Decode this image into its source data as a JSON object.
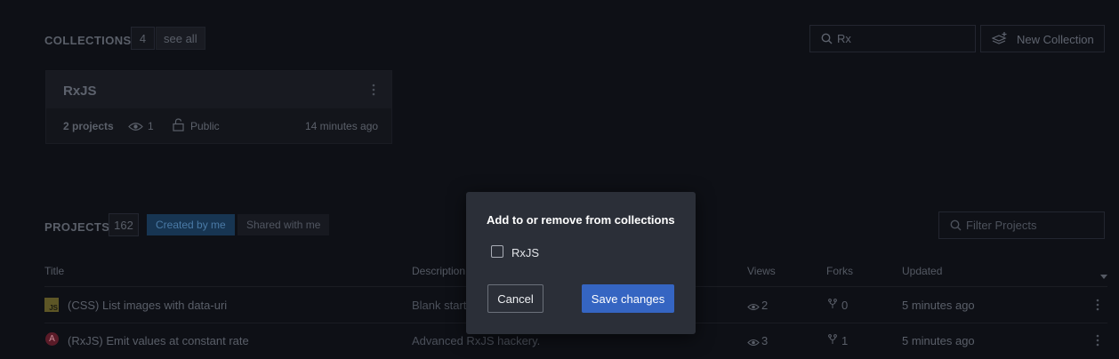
{
  "collections": {
    "title": "COLLECTIONS",
    "count": "4",
    "see_all": "see all",
    "search_value": "Rx",
    "new_button": "New Collection",
    "card": {
      "title": "RxJS",
      "projects": "2 projects",
      "views": "1",
      "visibility": "Public",
      "updated": "14 minutes ago"
    }
  },
  "projects": {
    "title": "PROJECTS",
    "count": "162",
    "tabs": [
      "Created by me",
      "Shared with me"
    ],
    "filter_placeholder": "Filter Projects",
    "columns": [
      "Title",
      "Description",
      "Views",
      "Forks",
      "Updated"
    ],
    "rows": [
      {
        "badge": "JS",
        "title": "(CSS) List images with data-uri",
        "description": "Blank start",
        "views": "2",
        "forks": "0",
        "updated": "5 minutes ago"
      },
      {
        "badge": "A",
        "title": "(RxJS) Emit values at constant rate",
        "description": "Advanced RxJS hackery.",
        "views": "3",
        "forks": "1",
        "updated": "5 minutes ago"
      }
    ]
  },
  "modal": {
    "title": "Add to or remove from collections",
    "option_label": "RxJS",
    "cancel": "Cancel",
    "save": "Save changes"
  },
  "colors": {
    "background": "#0e1016",
    "modal_bg": "#2b2f38",
    "primary": "#3565c2",
    "active_tab": "#173552"
  }
}
